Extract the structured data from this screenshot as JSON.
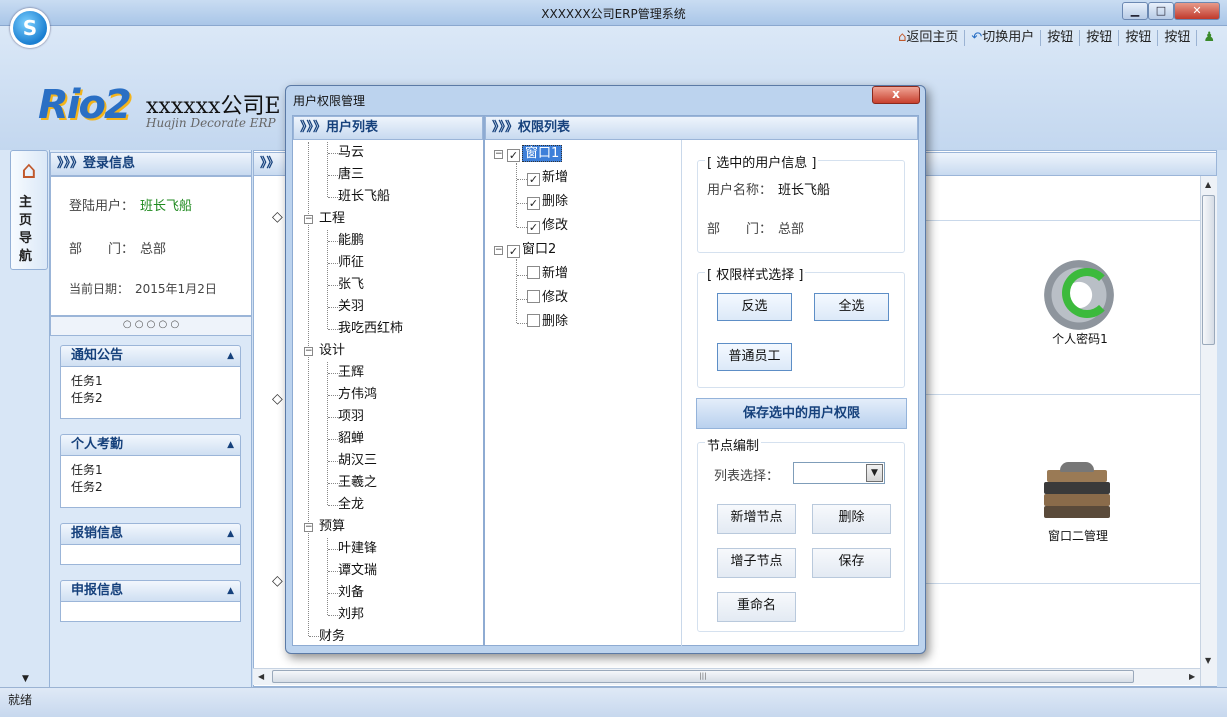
{
  "window": {
    "title": "XXXXXX公司ERP管理系统",
    "min": "▁",
    "max": "□",
    "close": "✕"
  },
  "toolbar": [
    "返回主页",
    "切换用户",
    "按钮",
    "按钮",
    "按钮",
    "按钮"
  ],
  "header": {
    "company": "xxxxxx公司ERP管理系统",
    "company_visible": "xxxxxx公司E",
    "subtitle": "Huajin Decorate ERP",
    "logo": "Rio2"
  },
  "vnav": {
    "label": "主页导航"
  },
  "login": {
    "head": "》》》登录信息",
    "user_label": "登陆用户：",
    "user": "班长飞船",
    "dept_label": "部　　门：",
    "dept": "总部",
    "date_label": "当前日期：",
    "date": "2015年1月2日",
    "dots": "○ ○ ○ ○ ○"
  },
  "boxes": [
    {
      "title": "通知公告",
      "items": [
        "任务1",
        "任务2"
      ]
    },
    {
      "title": "个人考勤",
      "items": [
        "任务1",
        "任务2"
      ]
    },
    {
      "title": "报销信息",
      "items": []
    },
    {
      "title": "申报信息",
      "items": []
    }
  ],
  "main": {
    "head": "》》",
    "icons": [
      "个人密码1",
      "窗口二管理"
    ]
  },
  "status": "就绪",
  "dialog": {
    "title": "用户权限管理",
    "close": "x",
    "user_list_head": "》》》用户列表",
    "perm_list_head": "》》》权限列表",
    "tree": [
      {
        "name": "",
        "children": [
          "马云",
          "唐三",
          "班长飞船"
        ]
      },
      {
        "name": "工程",
        "children": [
          "能鹏",
          "师征",
          "张飞",
          "关羽",
          "我吃西红柿"
        ]
      },
      {
        "name": "设计",
        "children": [
          "王辉",
          "方伟鸿",
          "项羽",
          "貂蝉",
          "胡汉三",
          "王羲之",
          "全龙"
        ]
      },
      {
        "name": "预算",
        "children": [
          "叶建锋",
          "谭文瑞",
          "刘备",
          "刘邦"
        ]
      },
      {
        "name": "财务",
        "children": []
      }
    ],
    "perms": [
      {
        "name": "窗口1",
        "checked": true,
        "children": [
          {
            "name": "新增",
            "checked": true
          },
          {
            "name": "删除",
            "checked": true
          },
          {
            "name": "修改",
            "checked": true
          }
        ]
      },
      {
        "name": "窗口2",
        "checked": true,
        "children": [
          {
            "name": "新增",
            "checked": false
          },
          {
            "name": "修改",
            "checked": false
          },
          {
            "name": "删除",
            "checked": false
          }
        ]
      }
    ],
    "selected_user": {
      "group": "[ 选中的用户信息 ]",
      "name_label": "用户名称：",
      "name": "班长飞船",
      "dept_label": "部　　门：",
      "dept": "总部"
    },
    "style": {
      "group": "[ 权限样式选择 ]",
      "invert": "反选",
      "all": "全选",
      "normal": "普通员工"
    },
    "save": "保存选中的用户权限",
    "node": {
      "group": "节点编制",
      "list_label": "列表选择：",
      "list_value": "",
      "add": "新增节点",
      "delete": "删除",
      "add_child": "增子节点",
      "save": "保存",
      "rename": "重命名"
    }
  }
}
